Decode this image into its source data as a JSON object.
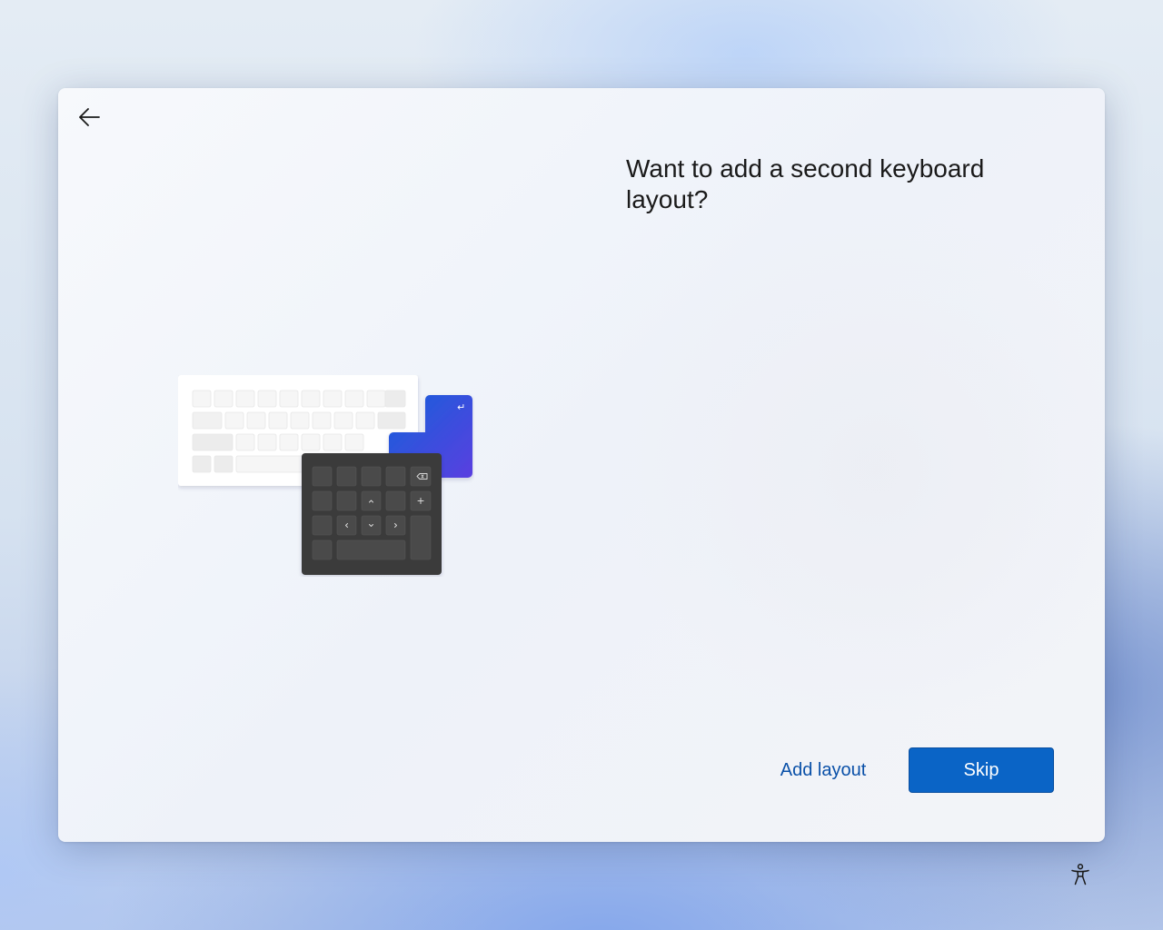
{
  "dialog": {
    "title": "Want to add a second keyboard layout?",
    "icons": {
      "back": "arrow-left-icon",
      "illustration": "keyboard-illustration",
      "enter_key_glyph": "↵",
      "backspace_glyph": "⌫"
    }
  },
  "actions": {
    "add_layout_label": "Add layout",
    "skip_label": "Skip"
  },
  "footer": {
    "accessibility_icon": "accessibility-icon"
  },
  "colors": {
    "primary_button": "#0a64c6",
    "link": "#0a50a8",
    "keypad": "#3b3b3b",
    "enter_key_gradient": [
      "#1a5fd9",
      "#5b3fe0"
    ]
  }
}
